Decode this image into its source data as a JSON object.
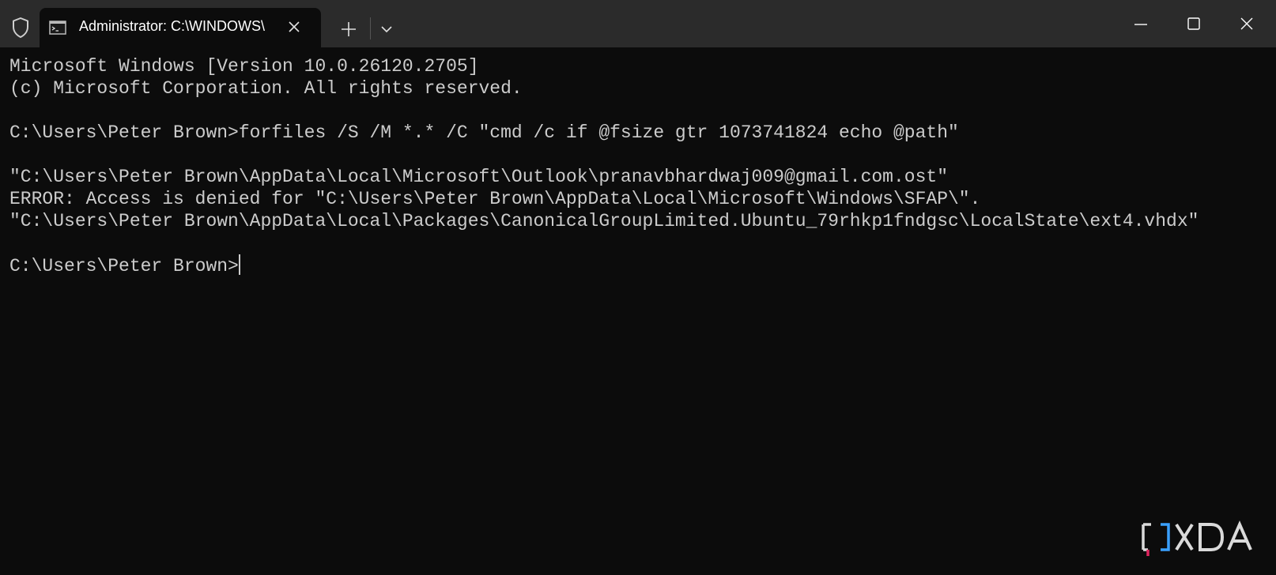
{
  "window": {
    "tab_title": "Administrator: C:\\WINDOWS\\",
    "background": "#0c0c0c",
    "titlebar_color": "#2b2b2b"
  },
  "icons": {
    "admin": "shield-icon",
    "tab": "terminal-icon",
    "close_tab": "close-icon",
    "new_tab": "plus-icon",
    "dropdown": "chevron-down-icon",
    "minimize": "minimize-icon",
    "maximize": "maximize-icon",
    "close_window": "close-icon"
  },
  "terminal": {
    "text_color": "#cccccc",
    "lines": [
      "Microsoft Windows [Version 10.0.26120.2705]",
      "(c) Microsoft Corporation. All rights reserved.",
      "",
      "C:\\Users\\Peter Brown>forfiles /S /M *.* /C \"cmd /c if @fsize gtr 1073741824 echo @path\"",
      "",
      "\"C:\\Users\\Peter Brown\\AppData\\Local\\Microsoft\\Outlook\\pranavbhardwaj009@gmail.com.ost\"",
      "ERROR: Access is denied for \"C:\\Users\\Peter Brown\\AppData\\Local\\Microsoft\\Windows\\SFAP\\\".",
      "\"C:\\Users\\Peter Brown\\AppData\\Local\\Packages\\CanonicalGroupLimited.Ubuntu_79rhkp1fndgsc\\LocalState\\ext4.vhdx\""
    ],
    "spacer": "",
    "prompt": "C:\\Users\\Peter Brown>"
  },
  "watermark": {
    "text": "XDA",
    "accent_color": "#e0245e"
  }
}
